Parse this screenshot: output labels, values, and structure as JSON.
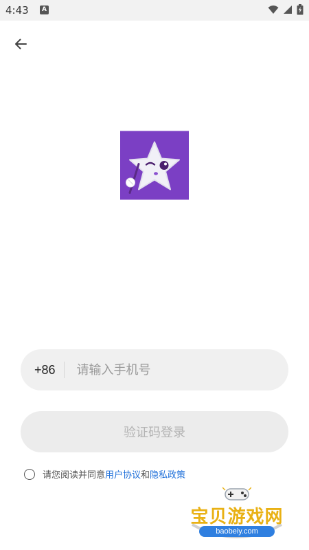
{
  "status_bar": {
    "time": "4:43",
    "notification_glyph": "A",
    "icons": [
      "wifi-icon",
      "signal-icon",
      "battery-charging-icon"
    ]
  },
  "nav": {
    "back_icon": "arrow-left-icon"
  },
  "app": {
    "logo_icon": "star-mascot-logo",
    "brand_color": "#7b3fc4"
  },
  "login": {
    "country_code": "+86",
    "phone_placeholder": "请输入手机号",
    "phone_value": "",
    "submit_label": "验证码登录"
  },
  "agreement": {
    "checked": false,
    "prefix": "请您阅读并同意",
    "user_agreement": "用户协议",
    "conjunction": "和",
    "privacy_policy": "隐私政策",
    "link_color": "#1e6fd9"
  },
  "watermark": {
    "title": "宝贝游戏网",
    "domain": "baobeiy.com"
  }
}
